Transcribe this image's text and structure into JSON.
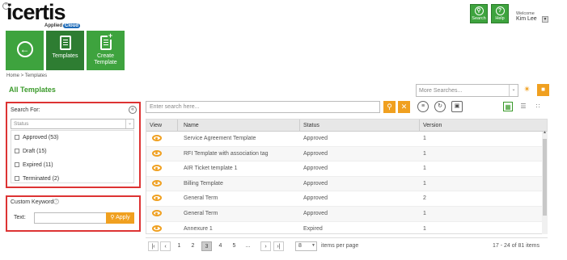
{
  "header": {
    "logo_text": "icertis",
    "tagline_a": "Applied",
    "tagline_b": "Cloud",
    "search_btn": "Search",
    "help_btn": "Help",
    "welcome": "Welcome",
    "user": "Kim Lee"
  },
  "tiles": {
    "templates": "Templates",
    "create_template": "Create Template"
  },
  "breadcrumb": "Home > Templates",
  "page_title": "All Templates",
  "more_searches_placeholder": "More Searches...",
  "search_panel": {
    "title": "Search For:",
    "status_placeholder": "Status",
    "statuses": [
      "Approved (53)",
      "Draft (15)",
      "Expired (11)",
      "Terminated (2)"
    ]
  },
  "keyword_panel": {
    "title": "Custom Keyword",
    "text_label": "Text:",
    "apply": "Apply"
  },
  "toolbar": {
    "search_placeholder": "Enter search here..."
  },
  "grid": {
    "columns": [
      "View",
      "Name",
      "Status",
      "Version"
    ],
    "rows": [
      {
        "name": "Service Agreement Template",
        "status": "Approved",
        "version": "1"
      },
      {
        "name": "RFI Template with association tag",
        "status": "Approved",
        "version": "1"
      },
      {
        "name": "AIR Ticket template 1",
        "status": "Approved",
        "version": "1"
      },
      {
        "name": "Billing Template",
        "status": "Approved",
        "version": "1"
      },
      {
        "name": "General Term",
        "status": "Approved",
        "version": "2"
      },
      {
        "name": "General Term",
        "status": "Approved",
        "version": "1"
      },
      {
        "name": "Annexure 1",
        "status": "Expired",
        "version": "1"
      }
    ]
  },
  "pager": {
    "pages": [
      "1",
      "2",
      "3",
      "4",
      "5",
      "..."
    ],
    "current": "3",
    "per_page": "8",
    "per_page_label": "items per page",
    "info": "17 - 24 of 81 items"
  },
  "colors": {
    "brand_green": "#3ea33e",
    "accent_orange": "#f0a020",
    "highlight_red": "#d33"
  }
}
